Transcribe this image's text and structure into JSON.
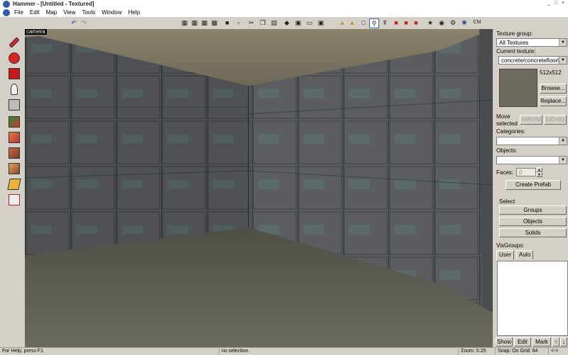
{
  "window": {
    "title": "Hammer - [Untitled - Textured]"
  },
  "menu": [
    "File",
    "Edit",
    "Map",
    "View",
    "Tools",
    "Window",
    "Help"
  ],
  "toolbar": {
    "icons": [
      "undo-icon",
      "redo-icon",
      "grid-icon",
      "grid-larger-icon",
      "grid-smaller-icon",
      "3d-grid-icon",
      "camera-icon",
      "select-icon",
      "cut-icon",
      "copy-icon",
      "paste-icon",
      "carve-icon",
      "texture-lock-icon",
      "ignore-groups-icon",
      "hide-items-icon",
      "group-icon",
      "ungroup-icon",
      "move-selected-icon",
      "compile-icon",
      "check-problems-icon",
      "entity-report-icon",
      "smooth-icon",
      "cordon-icon",
      "settings-icon"
    ]
  },
  "viewport": {
    "label": "camera"
  },
  "tools": [
    "selection-tool",
    "magnify-tool",
    "camera-tool",
    "entity-tool",
    "block-tool",
    "texture-application-tool",
    "apply-current-texture-tool",
    "decal-tool",
    "overlay-tool",
    "clipping-tool",
    "vertex-tool",
    "path-tool"
  ],
  "texture": {
    "group_label": "Texture group:",
    "group_value": "All Textures",
    "current_label": "Current texture:",
    "current_value": "concrete/concretefloor01:",
    "size": "512x512",
    "browse": "Browse...",
    "replace": "Replace..."
  },
  "move": {
    "label": "Move selected",
    "to_world": "toWorld",
    "to_entity": "toEntity"
  },
  "categories": {
    "label": "Categories:",
    "value": ""
  },
  "objects": {
    "label": "Objects:",
    "value": ""
  },
  "faces": {
    "label": "Faces:",
    "value": "0"
  },
  "create_prefab": "Create Prefab",
  "select": {
    "label": "Select",
    "groups": "Groups",
    "objects": "Objects",
    "solids": "Solids"
  },
  "visgroups": {
    "label": "VisGroups:",
    "tab_user": "User",
    "tab_auto": "Auto",
    "show": "Show",
    "edit": "Edit",
    "mark": "Mark"
  },
  "status": {
    "help": "For Help, press F1",
    "selection": "no selection.",
    "zoom": "Zoom: 0.25",
    "snap": "Snap: On Grid: 64",
    "extra": "<->"
  }
}
